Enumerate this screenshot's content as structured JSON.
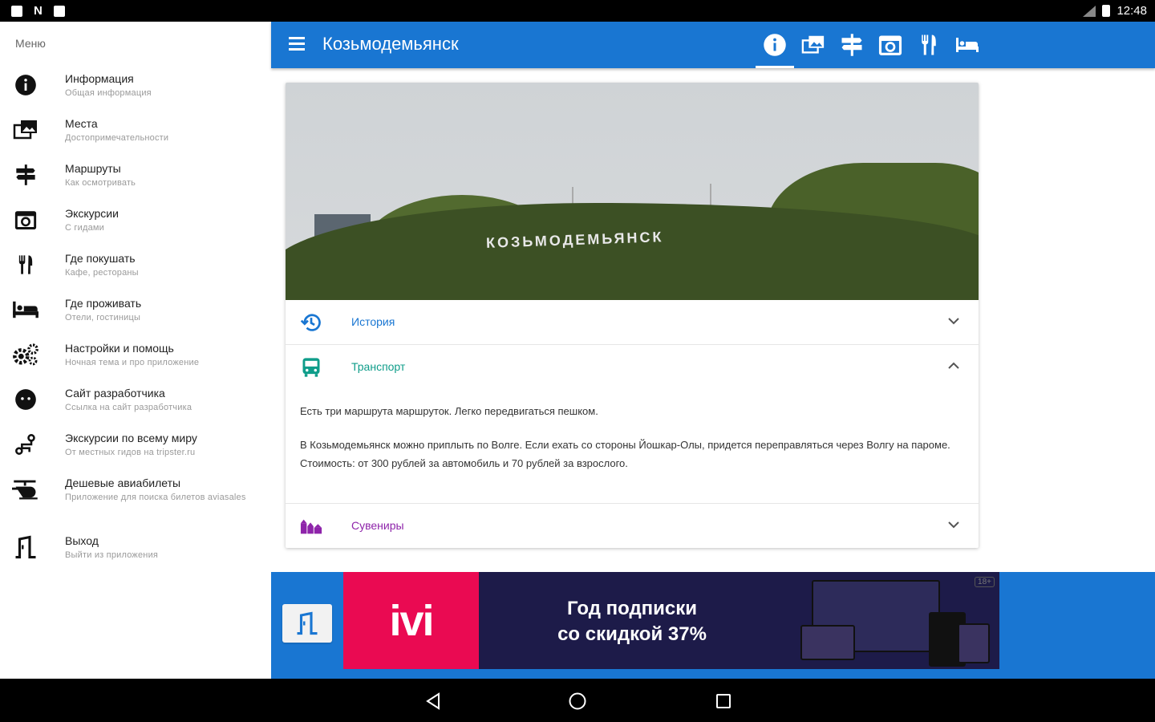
{
  "status_bar": {
    "time": "12:48"
  },
  "drawer": {
    "title": "Меню",
    "items": [
      {
        "label": "Информация",
        "sub": "Общая информация",
        "icon": "info-icon"
      },
      {
        "label": "Места",
        "sub": "Достопримечательности",
        "icon": "places-icon"
      },
      {
        "label": "Маршруты",
        "sub": "Как осмотривать",
        "icon": "signpost-icon"
      },
      {
        "label": "Экскурсии",
        "sub": "С гидами",
        "icon": "camera-icon"
      },
      {
        "label": "Где покушать",
        "sub": "Кафе, рестораны",
        "icon": "restaurant-icon"
      },
      {
        "label": "Где проживать",
        "sub": "Отели, гостиницы",
        "icon": "hotel-icon"
      },
      {
        "label": "Настройки и помощь",
        "sub": "Ночная тема и про приложение",
        "icon": "settings-icon"
      },
      {
        "label": "Сайт разработчика",
        "sub": "Ссылка на сайт разработчика",
        "icon": "developer-icon"
      },
      {
        "label": "Экскурсии по всему миру",
        "sub": "От местных гидов на tripster.ru",
        "icon": "route-icon"
      },
      {
        "label": "Дешевые авиабилеты",
        "sub": "Приложение для поиска билетов aviasales",
        "icon": "helicopter-icon"
      },
      {
        "label": "Выход",
        "sub": "Выйти из приложения",
        "icon": "exit-icon"
      }
    ]
  },
  "appbar": {
    "title": "Козьмодемьянск",
    "tabs": [
      "info-icon",
      "places-icon",
      "signpost-icon",
      "camera-icon",
      "restaurant-icon",
      "hotel-icon"
    ]
  },
  "card": {
    "photo_sign": "КОЗЬМОДЕМЬЯНСК",
    "sections": [
      {
        "label": "История",
        "color": "#1976d2",
        "icon": "history-icon",
        "expanded": false
      },
      {
        "label": "Транспорт",
        "color": "#0f9d8a",
        "icon": "bus-icon",
        "expanded": true
      },
      {
        "label": "Сувениры",
        "color": "#8e24aa",
        "icon": "souvenir-icon",
        "expanded": false
      }
    ],
    "transport_p1": "Есть три маршрута маршруток. Легко передвигаться пешком.",
    "transport_p2": "В Козьмодемьянск можно приплыть по Волге. Если ехать со стороны Йошкар-Олы, придется переправляться через Волгу на пароме. Стоимость: от 300 рублей за автомобиль и 70 рублей за взрослого."
  },
  "ad": {
    "logo": "ivi",
    "line1": "Год подписки",
    "line2": "со скидкой 37%",
    "age": "18+"
  },
  "colors": {
    "primary": "#1976d2",
    "ad_pink": "#ea0a52",
    "ad_bg": "#1d1b49"
  }
}
